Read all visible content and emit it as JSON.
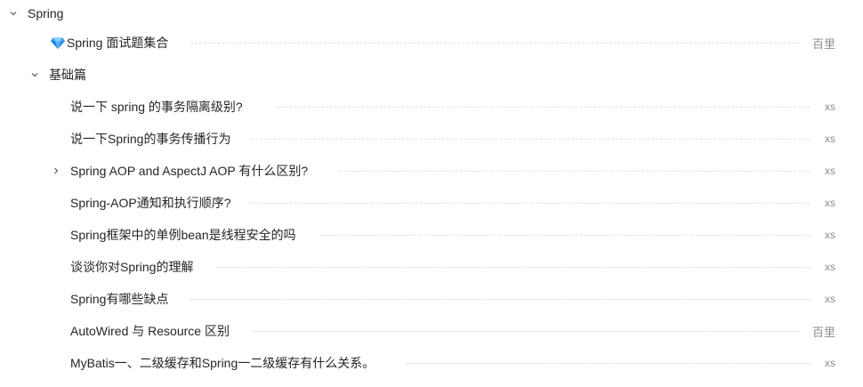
{
  "root": {
    "label": "Spring",
    "expanded": true
  },
  "featured": {
    "label": "Spring 面试题集合",
    "author": "百里",
    "icon": "diamond-icon"
  },
  "section": {
    "label": "基础篇",
    "expanded": true
  },
  "items": [
    {
      "label": "说一下 spring 的事务隔离级别?",
      "author": "xs",
      "has_children": false
    },
    {
      "label": "说一下Spring的事务传播行为",
      "author": "xs",
      "has_children": false
    },
    {
      "label": "Spring AOP and AspectJ AOP 有什么区别?",
      "author": "xs",
      "has_children": true
    },
    {
      "label": "Spring-AOP通知和执行顺序?",
      "author": "xs",
      "has_children": false
    },
    {
      "label": "Spring框架中的单例bean是线程安全的吗",
      "author": "xs",
      "has_children": false
    },
    {
      "label": "谈谈你对Spring的理解",
      "author": "xs",
      "has_children": false
    },
    {
      "label": "Spring有哪些缺点",
      "author": "xs",
      "has_children": false
    },
    {
      "label": "AutoWired 与 Resource 区别",
      "author": "百里",
      "has_children": false
    },
    {
      "label": "MyBatis一、二级缓存和Spring一二级缓存有什么关系。",
      "author": "xs",
      "has_children": false
    }
  ],
  "colors": {
    "text": "#262626",
    "muted": "#8c8c8c",
    "divider": "#e0e0e0"
  }
}
